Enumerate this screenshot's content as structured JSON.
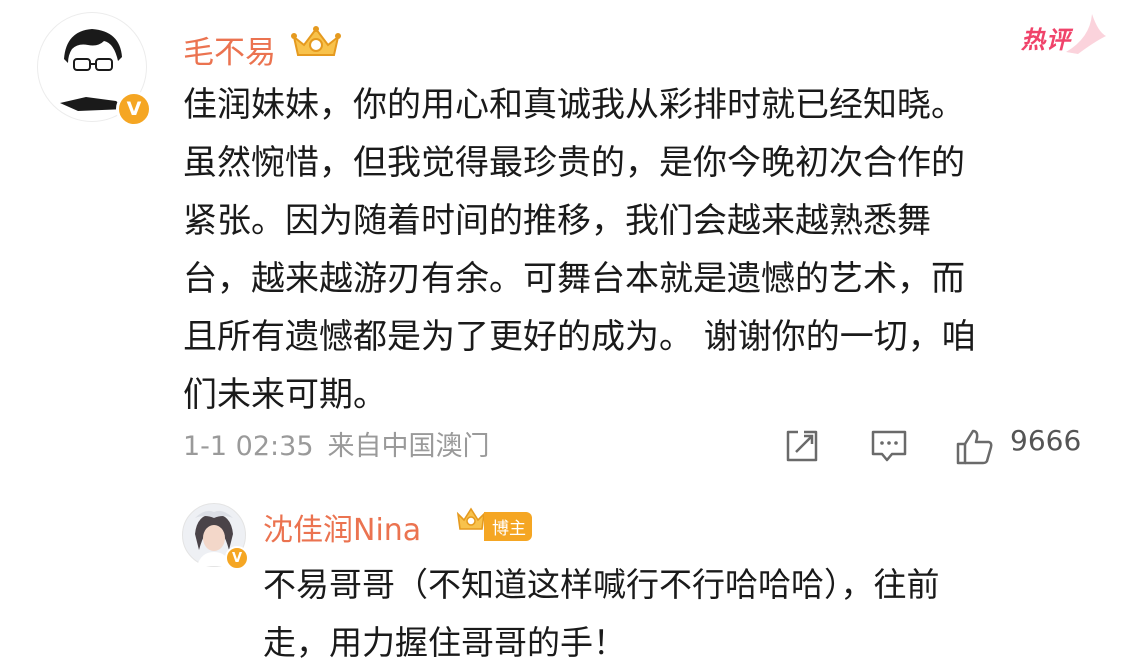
{
  "comment": {
    "username": "毛不易",
    "verified_badge": "V",
    "hot_tag": "热评",
    "lines": [
      "佳润妹妹，你的用心和真诚我从彩排时就已经知晓。",
      "虽然惋惜，但我觉得最珍贵的，是你今晚初次合作的",
      "紧张。因为随着时间的推移，我们会越来越熟悉舞",
      "台，越来越游刃有余。可舞台本就是遗憾的艺术，而",
      "且所有遗憾都是为了更好的成为。 谢谢你的一切，咱",
      "们未来可期。"
    ],
    "timestamp": "1-1 02:35",
    "source": "来自中国澳门",
    "like_count": "9666",
    "icons": [
      "crown-icon",
      "repost-icon",
      "comment-icon",
      "like-icon"
    ]
  },
  "reply": {
    "username": "沈佳润Nina",
    "verified_badge": "V",
    "badge_label": "博主",
    "lines": [
      "不易哥哥（不知道这样喊行不行哈哈哈），往前",
      "走，用力握住哥哥的手！"
    ]
  },
  "colors": {
    "username": "#eb7350",
    "hot": "#f0436a",
    "verified": "#f5a623",
    "meta": "#9a9a9a"
  }
}
